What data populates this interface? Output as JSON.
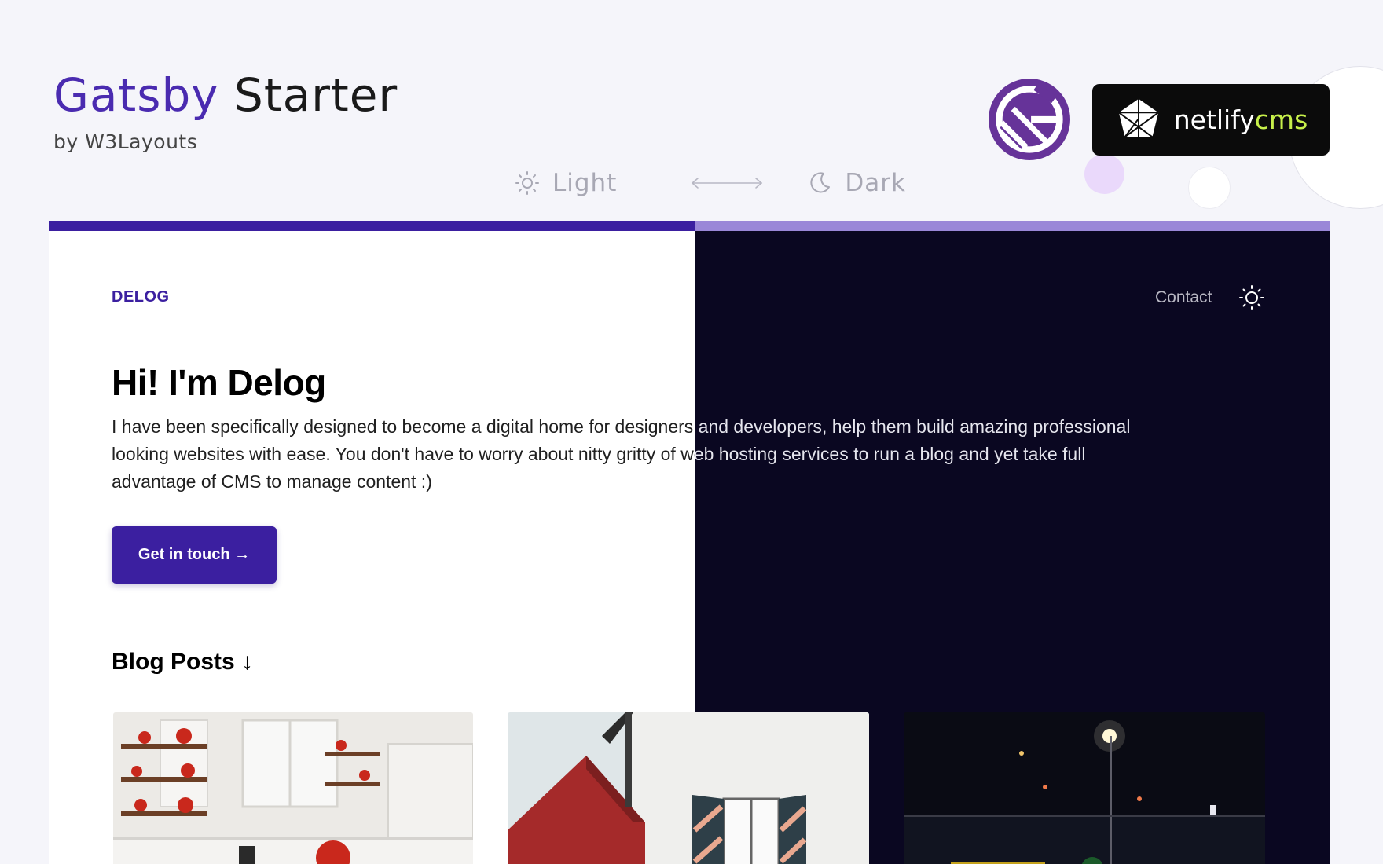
{
  "header": {
    "title_accent": "Gatsby",
    "title_rest": "Starter",
    "byline": "by W3Layouts"
  },
  "theme_toggle": {
    "light_label": "Light",
    "dark_label": "Dark",
    "light_icon": "sun-icon",
    "dark_icon": "moon-icon"
  },
  "badges": {
    "gatsby_icon": "gatsby-logo-icon",
    "netlify_word": "netlify",
    "cms_word": "cms"
  },
  "preview": {
    "logo": "DELOG",
    "nav": {
      "contact": "Contact",
      "theme_icon": "sun-icon"
    },
    "hero": {
      "title": "Hi! I'm Delog",
      "description": "I have been specifically designed to become a digital home for designers and developers, help them build amazing professional looking websites with ease. You don't have to worry about nitty gritty of web hosting services to run a blog and yet take full advantage of CMS to manage content :)",
      "cta": "Get in touch →"
    },
    "blog": {
      "heading": "Blog Posts ↓"
    }
  },
  "colors": {
    "brand": "#3b1fa0",
    "brand_light": "#9a87d8",
    "dark_bg": "#0a0721",
    "page_bg": "#f5f5fa",
    "netlify_accent": "#c7f04a"
  }
}
